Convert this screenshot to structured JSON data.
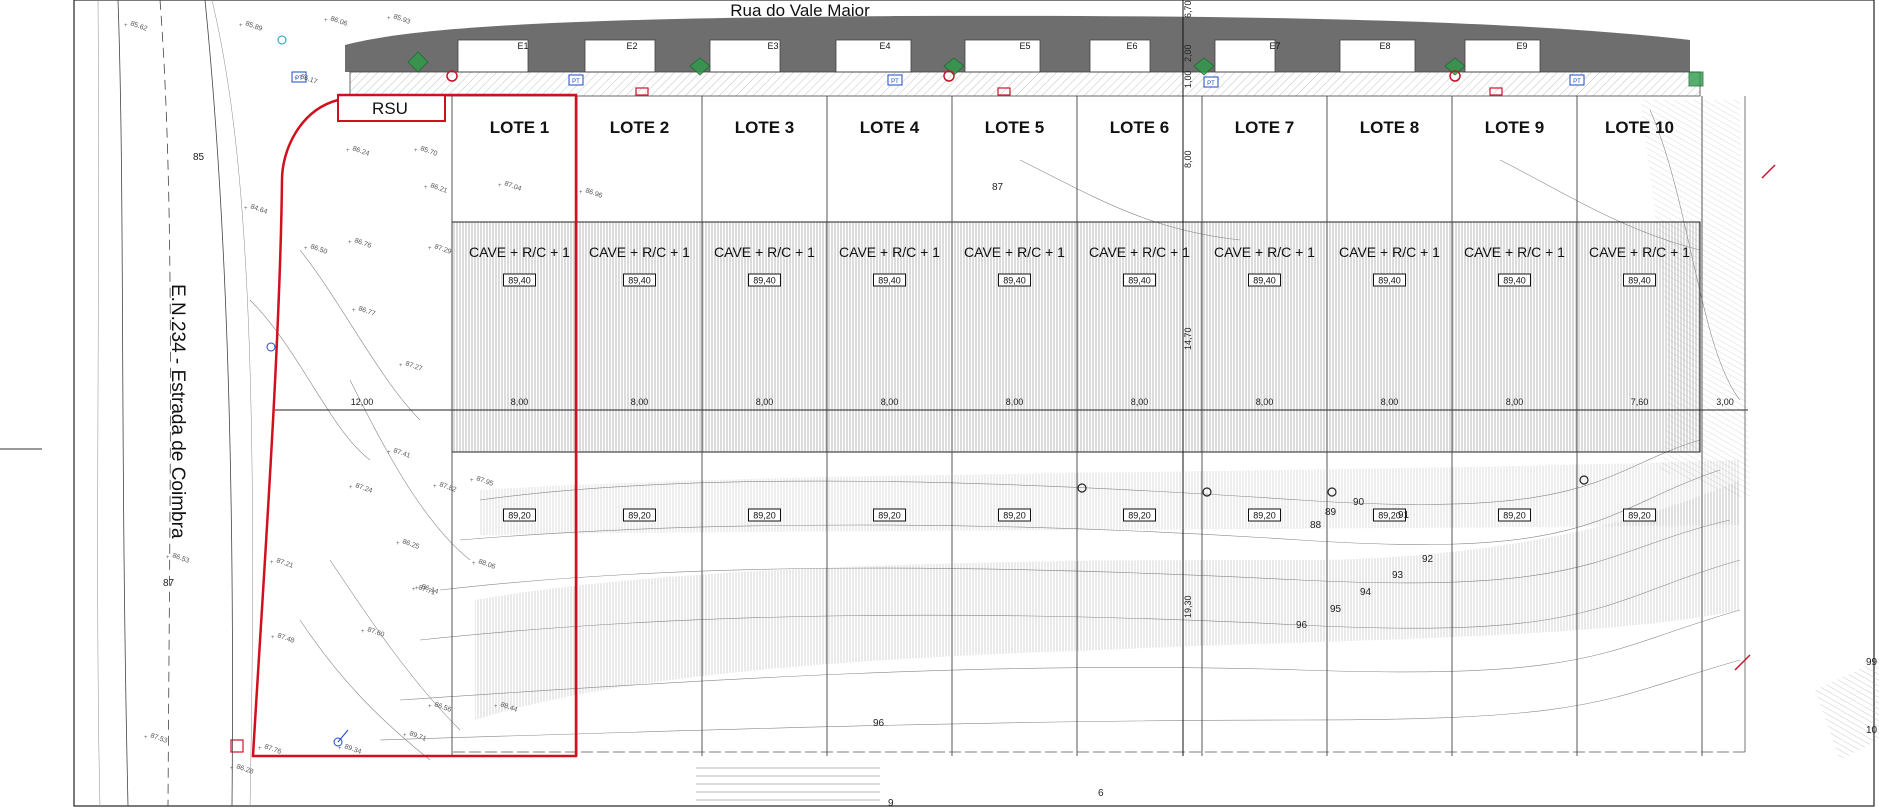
{
  "street_name": "Rua do Vale Maior",
  "road_name": "E.N.234 - Estrada de Coimbra",
  "rsu_label": "RSU",
  "lots": [
    {
      "label": "LOTE 1",
      "building": "CAVE + R/C + 1",
      "front_level": "89,40",
      "back_level": "89,20",
      "width": "8,00"
    },
    {
      "label": "LOTE 2",
      "building": "CAVE + R/C + 1",
      "front_level": "89,40",
      "back_level": "89,20",
      "width": "8,00"
    },
    {
      "label": "LOTE 3",
      "building": "CAVE + R/C + 1",
      "front_level": "89,40",
      "back_level": "89,20",
      "width": "8,00"
    },
    {
      "label": "LOTE 4",
      "building": "CAVE + R/C + 1",
      "front_level": "89,40",
      "back_level": "89,20",
      "width": "8,00"
    },
    {
      "label": "LOTE 5",
      "building": "CAVE + R/C + 1",
      "front_level": "89,40",
      "back_level": "89,20",
      "width": "8,00"
    },
    {
      "label": "LOTE 6",
      "building": "CAVE + R/C + 1",
      "front_level": "89,40",
      "back_level": "89,20",
      "width": "8,00"
    },
    {
      "label": "LOTE 7",
      "building": "CAVE + R/C + 1",
      "front_level": "89,40",
      "back_level": "89,20",
      "width": "8,00"
    },
    {
      "label": "LOTE 8",
      "building": "CAVE + R/C + 1",
      "front_level": "89,40",
      "back_level": "89,20",
      "width": "8,00"
    },
    {
      "label": "LOTE 9",
      "building": "CAVE + R/C + 1",
      "front_level": "89,40",
      "back_level": "89,20",
      "width": "8,00"
    },
    {
      "label": "LOTE 10",
      "building": "CAVE + R/C + 1",
      "front_level": "89,40",
      "back_level": "89,20",
      "width": "7,60"
    }
  ],
  "parking_labels": [
    "E1",
    "E2",
    "E3",
    "E4",
    "E5",
    "E6",
    "E7",
    "E8",
    "E9"
  ],
  "dimensions": {
    "left_setback": "12,00",
    "right_setback": "3,00",
    "top_a": "6,70",
    "top_b": "2,00",
    "top_c": "1,00",
    "front_depth": "8,00",
    "building_depth": "14,70",
    "back_depth": "19,30"
  },
  "contours": [
    "87",
    "88",
    "89",
    "90",
    "91",
    "92",
    "93",
    "94",
    "95",
    "96",
    "96",
    "99",
    "10",
    "85",
    "87",
    "9",
    "6"
  ],
  "spot_heights": [
    "85.62",
    "85.89",
    "86.06",
    "85.93",
    "86.17",
    "84.64",
    "86.24",
    "85.70",
    "86.21",
    "87.04",
    "86.96",
    "86.76",
    "87.29",
    "86.50",
    "86.77",
    "87.27",
    "87.41",
    "87.24",
    "87.82",
    "86.25",
    "87.71",
    "86.14",
    "87.60",
    "87.48",
    "86.56",
    "87.21",
    "87.76",
    "86.28",
    "89.34",
    "89.71",
    "86.53",
    "88.44",
    "87.95",
    "88.06",
    "87.53"
  ],
  "symbols": {
    "pt": "PT"
  },
  "colors": {
    "boundary": "#d0101c",
    "hatch": "#777777",
    "dark_band": "#6e6e6e",
    "tree": "#2e9b4a",
    "symbol_blue": "#1b49c9",
    "symbol_red": "#c8142a",
    "symbol_purple": "#8a3fb0",
    "symbol_cyan": "#10a0b8",
    "symbol_orange": "#c07a20"
  }
}
